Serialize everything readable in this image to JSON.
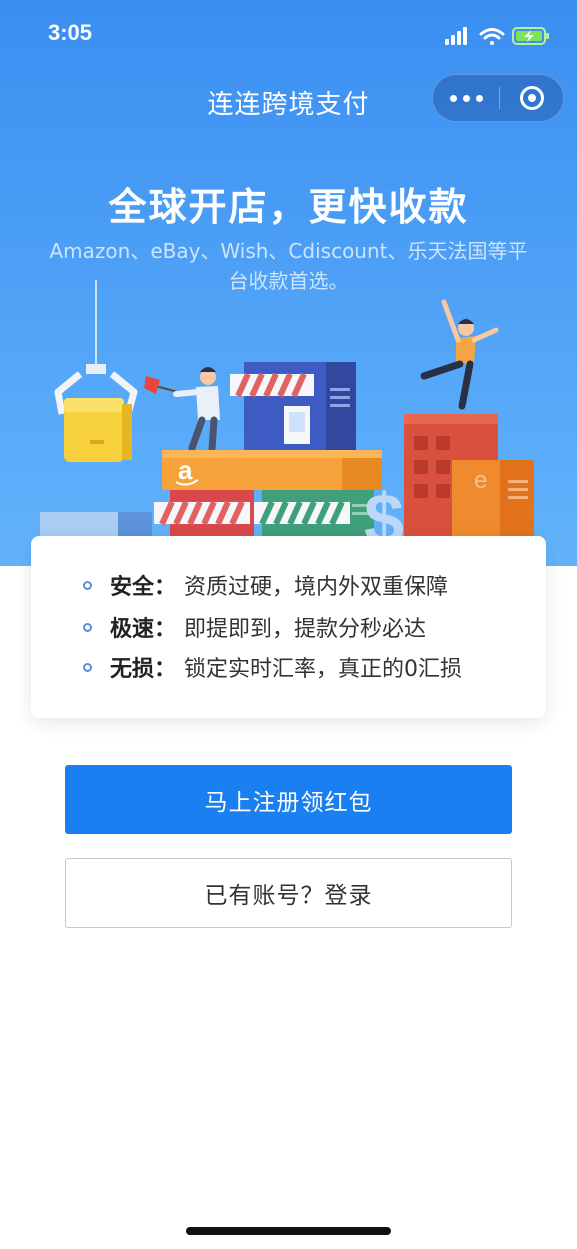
{
  "status_bar": {
    "time": "3:05",
    "icons": [
      "signal-icon",
      "wifi-icon",
      "battery-charging-icon"
    ]
  },
  "nav": {
    "title": "连连跨境支付",
    "more_icon": "more-dots-icon",
    "close_icon": "target-circle-icon"
  },
  "hero": {
    "headline": "全球开店，更快收款",
    "subline": "Amazon、eBay、Wish、Cdiscount、乐天法国等平台收款首选。",
    "illustration_letters": {
      "amazon_logo": "a",
      "ebay_logo": "e",
      "currency_symbol": "$"
    }
  },
  "features": [
    {
      "key": "安全",
      "colon": "：",
      "desc": "资质过硬，境内外双重保障"
    },
    {
      "key": "极速",
      "colon": "：",
      "desc": "即提即到，提款分秒必达"
    },
    {
      "key": "无损",
      "colon": "：",
      "desc": "锁定实时汇率，真正的0汇损"
    }
  ],
  "actions": {
    "register_label": "马上注册领红包",
    "login_label": "已有账号？登录"
  },
  "colors": {
    "hero_gradient_top": "#3a8ef0",
    "hero_gradient_bottom": "#63b3fb",
    "primary_button": "#1a7ff0",
    "bullet": "#5b8dd8"
  }
}
